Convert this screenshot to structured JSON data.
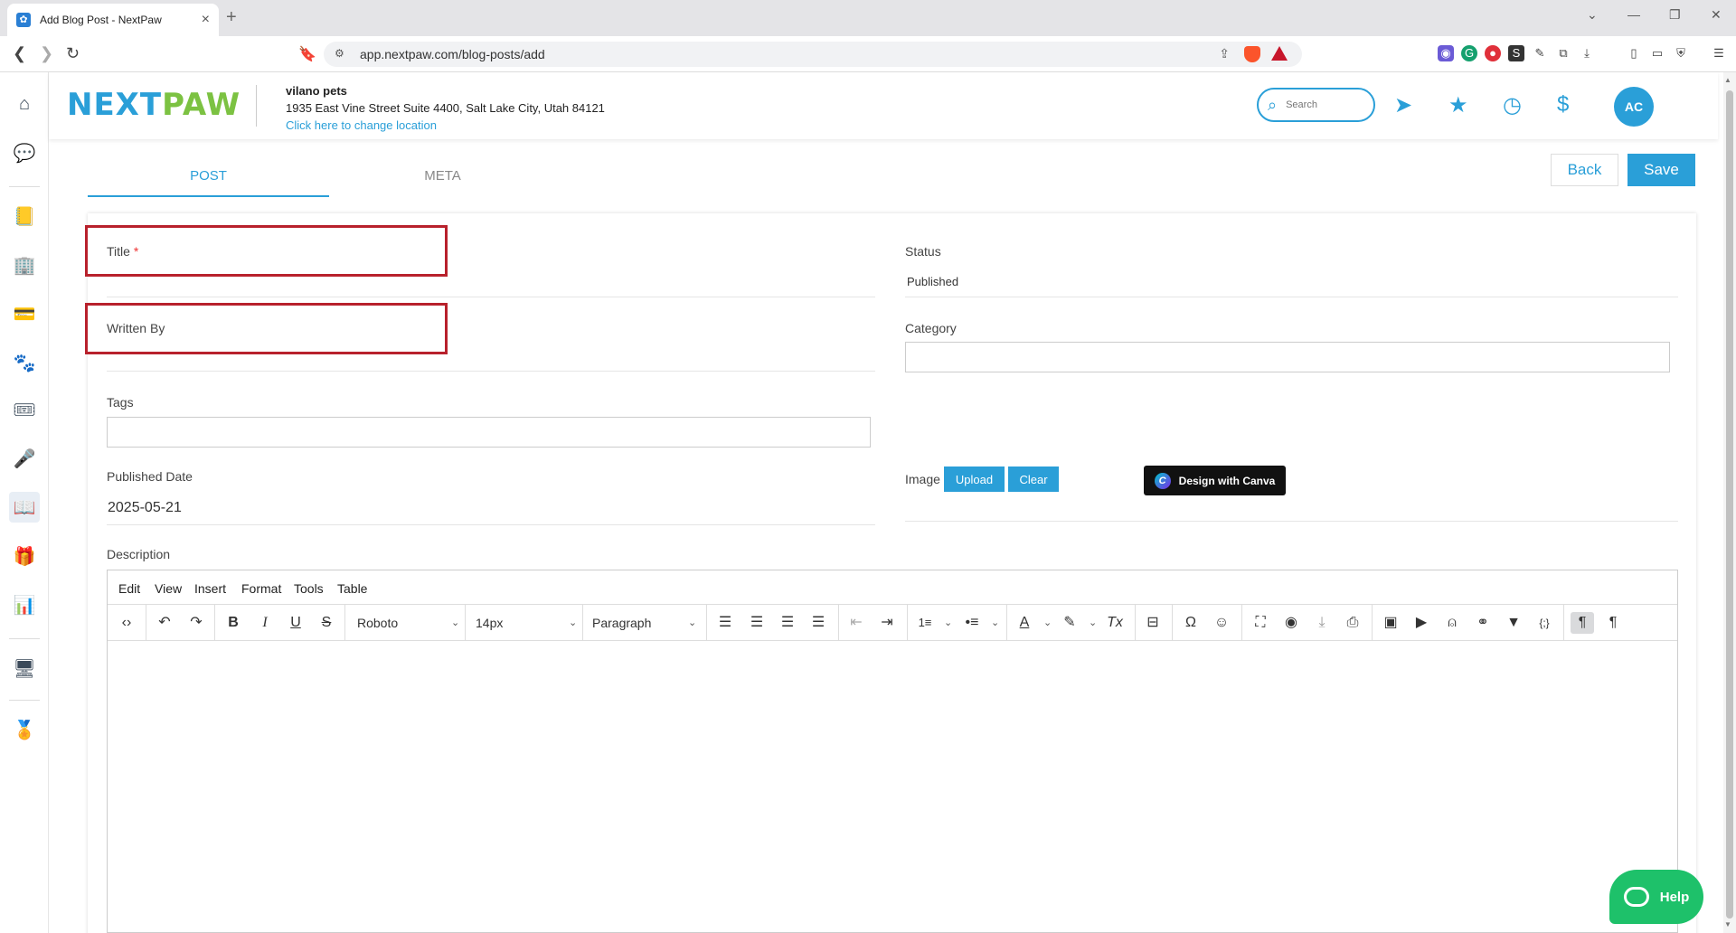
{
  "browser": {
    "tab_title": "Add Blog Post - NextPaw",
    "url": "app.nextpaw.com/blog-posts/add"
  },
  "header": {
    "logo_next": "NEXT",
    "logo_paw": "PAW",
    "location_name": "vilano pets",
    "location_address": "1935 East Vine Street Suite 4400, Salt Lake City, Utah 84121",
    "change_location_link": "Click here to change location",
    "search_placeholder": "Search",
    "avatar_initials": "AC"
  },
  "tabs": [
    {
      "label": "POST",
      "active": true
    },
    {
      "label": "META",
      "active": false
    }
  ],
  "actions": {
    "back_label": "Back",
    "save_label": "Save"
  },
  "form": {
    "title_label": "Title",
    "title_required": "*",
    "written_by_label": "Written By",
    "tags_label": "Tags",
    "published_date_label": "Published Date",
    "published_date_value": "2025-05-21",
    "status_label": "Status",
    "status_value": "Published",
    "category_label": "Category",
    "image_label": "Image",
    "upload_label": "Upload",
    "clear_label": "Clear",
    "canva_label": "Design with Canva",
    "description_label": "Description"
  },
  "editor": {
    "menu": [
      "Edit",
      "View",
      "Insert",
      "Format",
      "Tools",
      "Table"
    ],
    "font_family": "Roboto",
    "font_size": "14px",
    "block_format": "Paragraph"
  },
  "help": {
    "label": "Help"
  },
  "colors": {
    "accent": "#2a9fd8",
    "brand_green": "#7cc242",
    "highlight_box": "#b8212c",
    "help_green": "#1ec16a"
  }
}
